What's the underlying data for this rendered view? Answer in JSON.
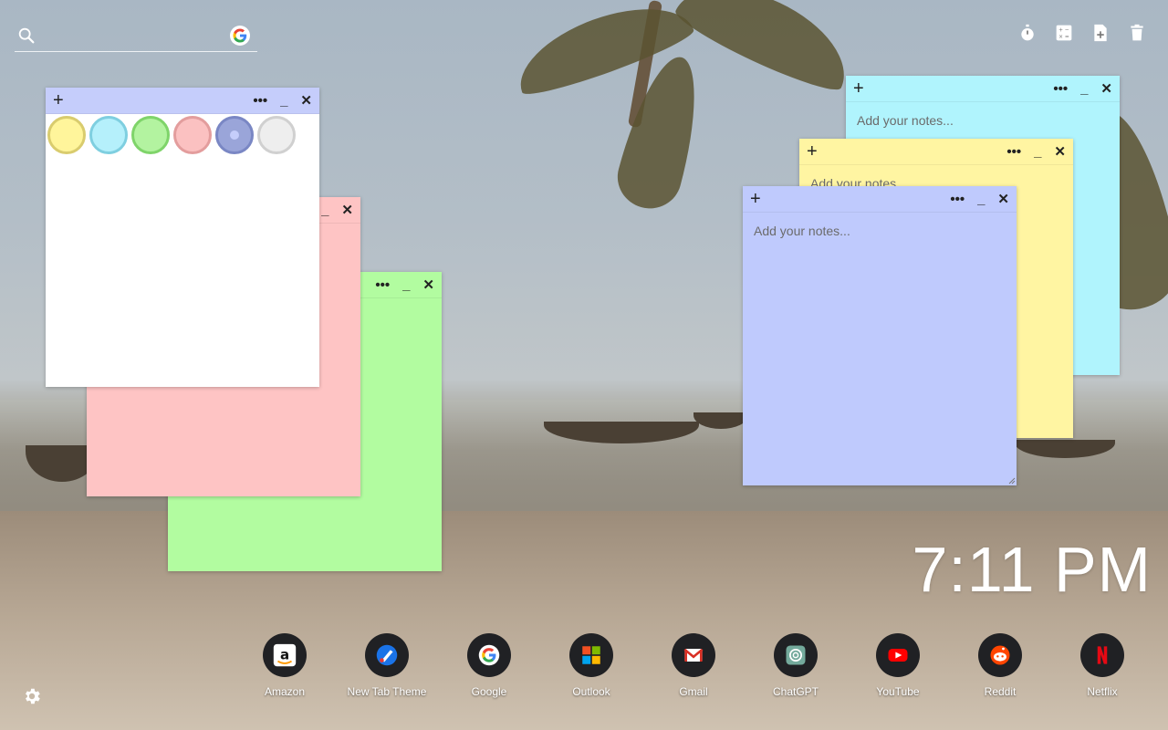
{
  "search": {
    "placeholder": "",
    "value": ""
  },
  "toolbar": {
    "icons": [
      "timer-icon",
      "calculator-icon",
      "new-note-icon",
      "trash-icon"
    ]
  },
  "note_controls": {
    "plus": "+",
    "more": "•••",
    "minimize": "_",
    "close": "✕"
  },
  "notes": {
    "palette_note": {
      "color": "#ffffff",
      "header_color": "#c5cdfb"
    },
    "pink_note": {
      "color": "#fec4c4"
    },
    "green_note": {
      "color": "#b2fca0"
    },
    "cyan_note": {
      "color": "#b0f4fd",
      "placeholder": "Add your notes..."
    },
    "yellow_note": {
      "color": "#fff5a2",
      "placeholder": "Add your notes..."
    },
    "blue_note": {
      "color": "#bfcafd",
      "placeholder": "Add your notes..."
    }
  },
  "palette": [
    {
      "name": "yellow",
      "fill": "#fff59b",
      "ring": "#d9cc6e"
    },
    {
      "name": "cyan",
      "fill": "#b5f0fb",
      "ring": "#7fcfe0"
    },
    {
      "name": "green",
      "fill": "#b3f3a0",
      "ring": "#7fd46a"
    },
    {
      "name": "pink",
      "fill": "#fbc1c1",
      "ring": "#e39d9d"
    },
    {
      "name": "blue",
      "fill": "#9aa5d9",
      "ring": "#7a87c4",
      "selected": true
    },
    {
      "name": "white",
      "fill": "#eeeeee",
      "ring": "#d0d0d0"
    }
  ],
  "clock": {
    "time": "7:11 PM"
  },
  "dock": [
    {
      "label": "Amazon",
      "icon": "amazon-icon"
    },
    {
      "label": "New Tab Theme",
      "icon": "new-tab-theme-icon"
    },
    {
      "label": "Google",
      "icon": "google-icon"
    },
    {
      "label": "Outlook",
      "icon": "outlook-icon"
    },
    {
      "label": "Gmail",
      "icon": "gmail-icon"
    },
    {
      "label": "ChatGPT",
      "icon": "chatgpt-icon"
    },
    {
      "label": "YouTube",
      "icon": "youtube-icon"
    },
    {
      "label": "Reddit",
      "icon": "reddit-icon"
    },
    {
      "label": "Netflix",
      "icon": "netflix-icon"
    }
  ]
}
